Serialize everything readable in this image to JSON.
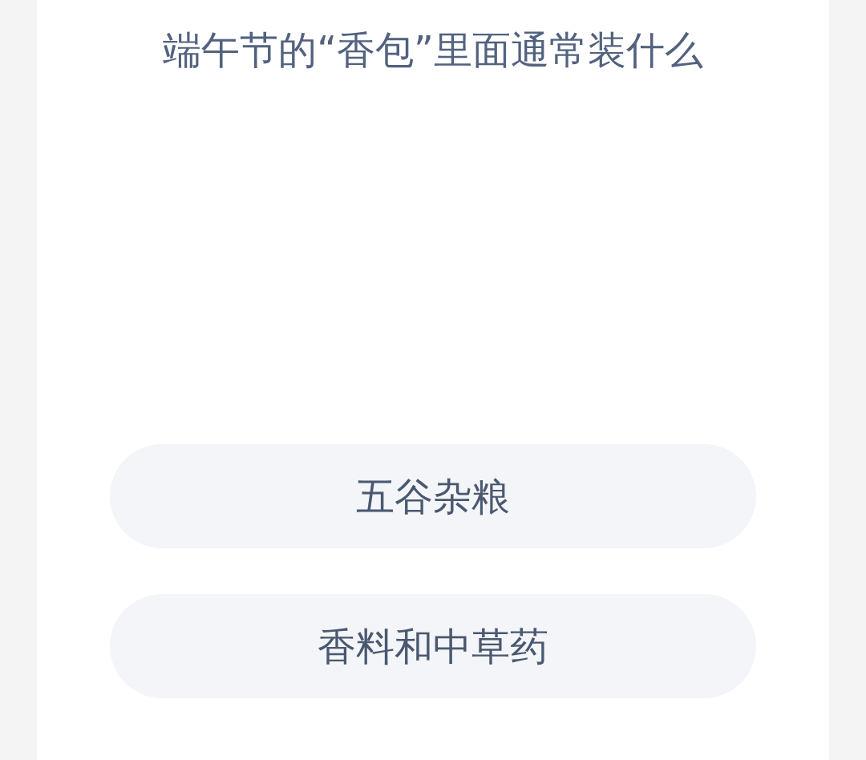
{
  "question": "端午节的“香包”里面通常装什么",
  "options": [
    {
      "label": "五谷杂粮"
    },
    {
      "label": "香料和中草药"
    }
  ]
}
